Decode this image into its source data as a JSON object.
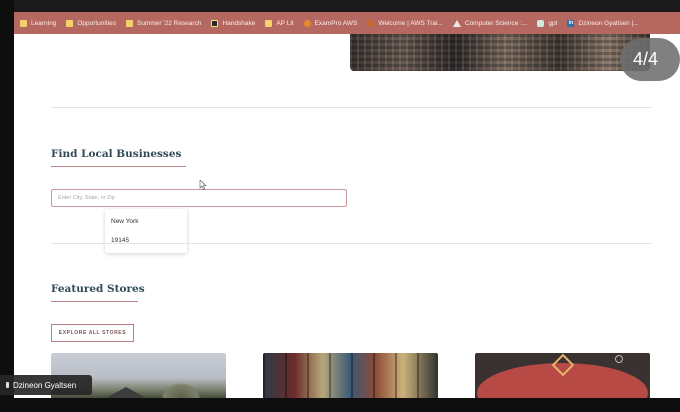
{
  "bookmarks": [
    {
      "label": "Learning",
      "icon": "folder-icon"
    },
    {
      "label": "Opportunities",
      "icon": "folder-icon"
    },
    {
      "label": "Summer '22 Research",
      "icon": "folder-icon"
    },
    {
      "label": "Handshake",
      "icon": "handshake-icon"
    },
    {
      "label": "AP Lit",
      "icon": "folder-icon"
    },
    {
      "label": "ExamPro AWS",
      "icon": "exampro-icon"
    },
    {
      "label": "Welcome | AWS Trai...",
      "icon": "aws-icon"
    },
    {
      "label": "Computer Science :...",
      "icon": "computer-science-icon"
    },
    {
      "label": "gpt",
      "icon": "gpt-icon"
    },
    {
      "label": "Dzineon Gyaltsen |...",
      "icon": "linkedin-icon"
    }
  ],
  "slideshow": {
    "counter": "4/4"
  },
  "find_section": {
    "title": "Find Local Businesses",
    "search_placeholder": "Enter City, State, or Zip",
    "suggestions": [
      "New York",
      "19145"
    ]
  },
  "featured_section": {
    "title": "Featured Stores",
    "button_label": "EXPLORE ALL STORES"
  },
  "participant": {
    "name": "Dzineon Gyaltsen"
  },
  "linkedin_badge": "in"
}
